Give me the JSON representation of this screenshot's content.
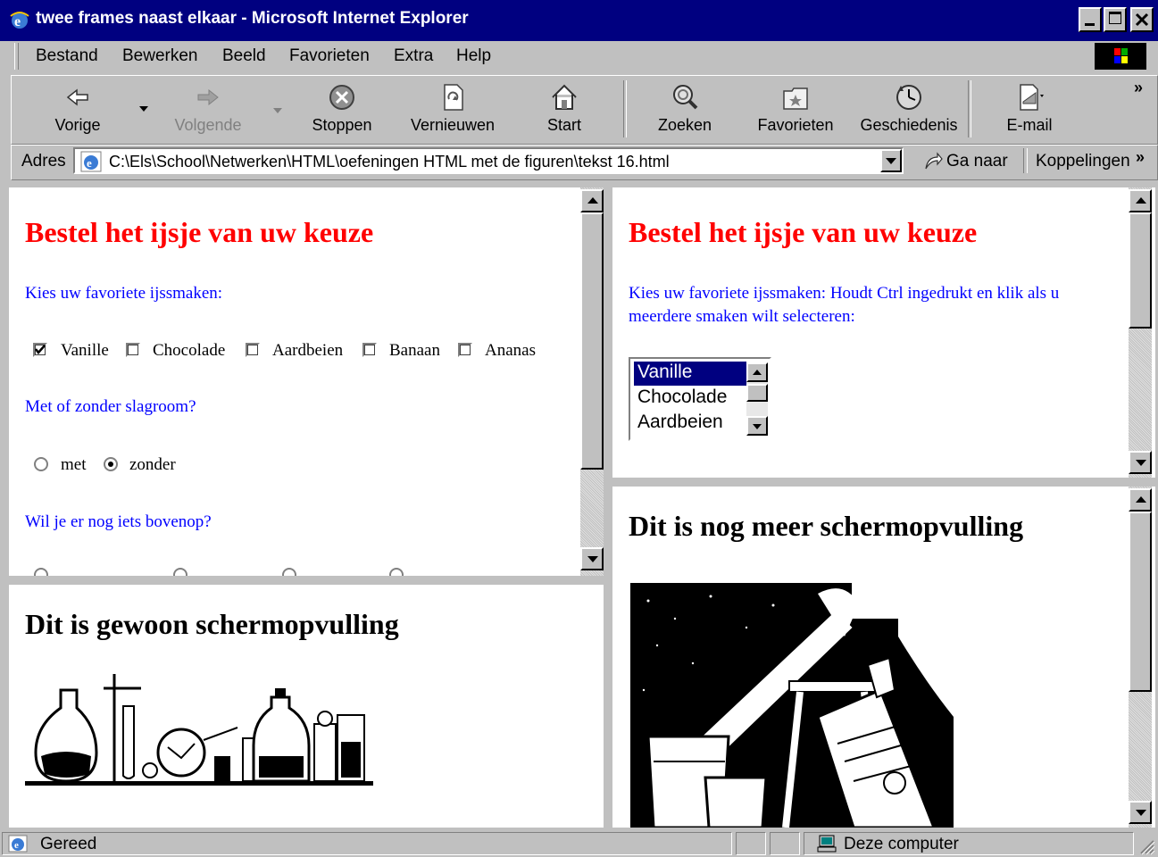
{
  "window": {
    "title": "twee frames naast elkaar - Microsoft Internet Explorer"
  },
  "menu": [
    "Bestand",
    "Bewerken",
    "Beeld",
    "Favorieten",
    "Extra",
    "Help"
  ],
  "toolbar": {
    "back": "Vorige",
    "forward": "Volgende",
    "stop": "Stoppen",
    "refresh": "Vernieuwen",
    "home": "Start",
    "search": "Zoeken",
    "favorites": "Favorieten",
    "history": "Geschiedenis",
    "mail": "E-mail",
    "more": "»"
  },
  "address": {
    "label": "Adres",
    "value": "C:\\Els\\School\\Netwerken\\HTML\\oefeningen HTML met de figuren\\tekst 16.html",
    "go": "Ga naar",
    "links": "Koppelingen",
    "links_more": "»"
  },
  "frame_top_left": {
    "heading": "Bestel het ijsje van uw keuze",
    "prompt": "Kies uw favoriete ijssmaken:",
    "flavors": [
      {
        "label": "Vanille",
        "checked": true
      },
      {
        "label": "Chocolade",
        "checked": false
      },
      {
        "label": "Aardbeien",
        "checked": false
      },
      {
        "label": "Banaan",
        "checked": false
      },
      {
        "label": "Ananas",
        "checked": false
      }
    ],
    "cream_question": "Met of zonder slagroom?",
    "cream_options": [
      {
        "label": "met",
        "selected": false
      },
      {
        "label": "zonder",
        "selected": true
      }
    ],
    "topping_question": "Wil je er nog iets bovenop?"
  },
  "frame_top_right": {
    "heading": "Bestel het ijsje van uw keuze",
    "prompt_line1": "Kies uw favoriete ijssmaken: Houdt Ctrl ingedrukt en klik als u",
    "prompt_line2": "meerdere smaken wilt selecteren:",
    "list_items": [
      {
        "label": "Vanille",
        "selected": true
      },
      {
        "label": "Chocolade",
        "selected": false
      },
      {
        "label": "Aardbeien",
        "selected": false
      }
    ]
  },
  "frame_bottom_left": {
    "heading": "Dit is gewoon schermopvulling"
  },
  "frame_bottom_right": {
    "heading": "Dit is nog meer schermopvulling"
  },
  "status": {
    "text": "Gereed",
    "zone": "Deze computer"
  },
  "colors": {
    "titlebar": "#000080",
    "heading_red": "#ff0000",
    "link_blue": "#0000ff",
    "selection": "#000080"
  }
}
